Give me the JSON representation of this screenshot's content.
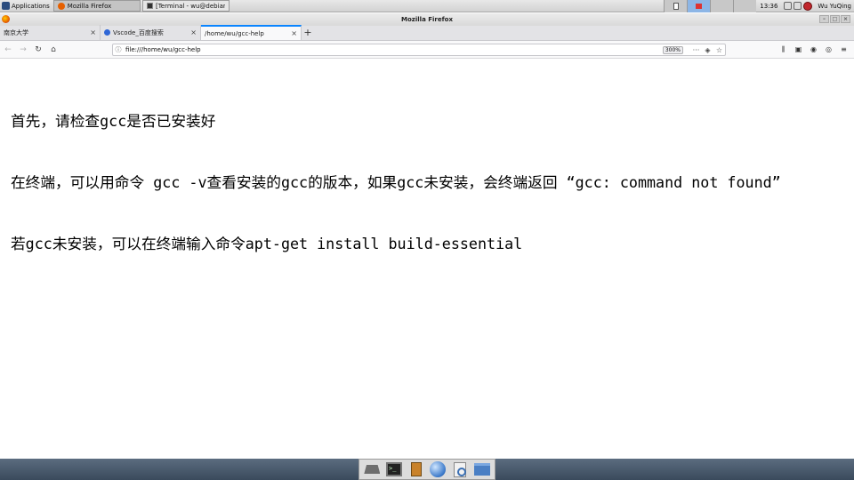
{
  "top_panel": {
    "applications_label": "Applications",
    "tasks": [
      {
        "label": "Mozilla Firefox",
        "active": true
      },
      {
        "label": "[Terminal - wu@debian:...",
        "active": false
      }
    ],
    "clock": "13:36",
    "user": "Wu YuQing"
  },
  "window": {
    "title": "Mozilla Firefox"
  },
  "tabs": [
    {
      "label": "南京大学",
      "close": "×"
    },
    {
      "label": "Vscode_百度搜索",
      "close": "×"
    },
    {
      "label": "/home/wu/gcc-help",
      "close": "×"
    }
  ],
  "new_tab_label": "+",
  "urlbar": {
    "url": "file:///home/wu/gcc-help",
    "zoom": "300%",
    "more": "···"
  },
  "document": {
    "lines": [
      "首先，请检查gcc是否已安装好",
      "在终端，可以用命令 gcc -v查看安装的gcc的版本，如果gcc未安装，会终端返回 “gcc: command not found”",
      "若gcc未安装，可以在终端输入命令apt-get install build-essential"
    ]
  },
  "dock": {
    "terminal_prompt": ">_"
  },
  "colors": {
    "tab_accent": "#0a84ff",
    "panel_bg": "#d8d8d8",
    "dock_bg": "#3a4a5c"
  }
}
